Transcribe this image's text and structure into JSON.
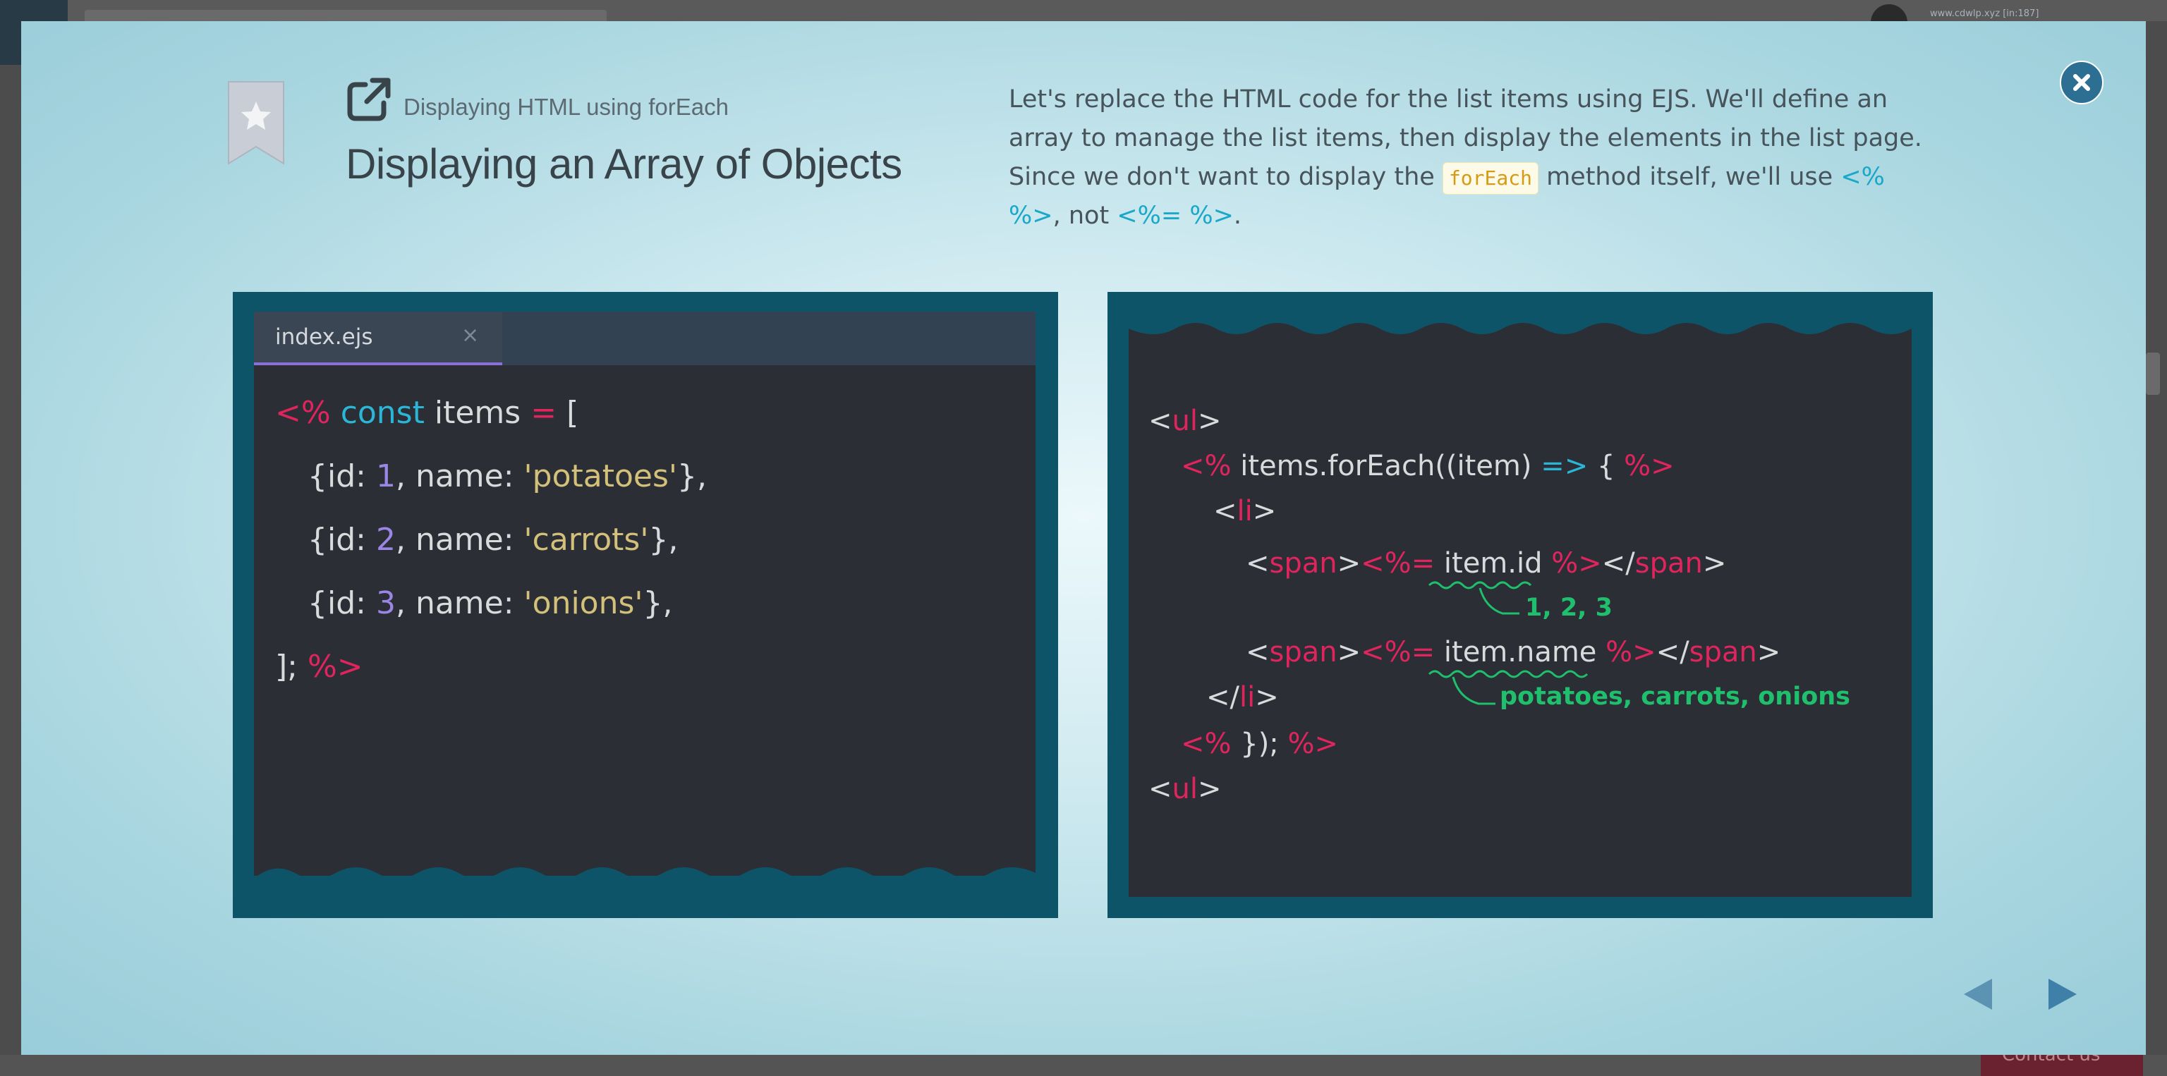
{
  "background": {
    "user_text": "www.cdwlp.xyz [in:187]",
    "contact_label": "Contact us"
  },
  "header": {
    "subtitle": "Displaying HTML using forEach",
    "title": "Displaying an Array of Objects"
  },
  "description": {
    "part1": "Let's replace the HTML code for the list items using EJS. We'll define an array to manage the list items, then display the elements in the list page. Since we don't want to display the ",
    "code": "forEach",
    "part2": " method itself, we'll use ",
    "token1": "<% %>",
    "part3": ", not ",
    "token2": "<%= %>",
    "part4": "."
  },
  "editor": {
    "tab_label": "index.ejs",
    "tab_close": "×"
  },
  "left_code": {
    "l1": {
      "a": "<%",
      "b": "const",
      "c": "items",
      "d": "=",
      "e": "["
    },
    "l2": {
      "a": "{id: ",
      "b": "1",
      "c": ", name: ",
      "d": "'potatoes'",
      "e": "},"
    },
    "l3": {
      "a": "{id: ",
      "b": "2",
      "c": ", name: ",
      "d": "'carrots'",
      "e": "},"
    },
    "l4": {
      "a": "{id: ",
      "b": "3",
      "c": ", name: ",
      "d": "'onions'",
      "e": "},"
    },
    "l5": {
      "a": "];",
      "b": "%>"
    }
  },
  "right_code": {
    "l1": {
      "a": "<",
      "b": "ul",
      "c": ">"
    },
    "l2": {
      "a": "<%",
      "b": "items.forEach((item)",
      "c": "=>",
      "d": "{",
      "e": "%>"
    },
    "l3": {
      "a": "<",
      "b": "li",
      "c": ">"
    },
    "l4": {
      "a": "<",
      "b": "span",
      "c": ">",
      "d": "<%=",
      "e": "item.id",
      "f": "%>",
      "g": "</",
      "h": "span",
      "i": ">"
    },
    "l5": {
      "a": "<",
      "b": "span",
      "c": ">",
      "d": "<%=",
      "e": "item.name",
      "f": "%>",
      "g": "</",
      "h": "span",
      "i": ">"
    },
    "l6": {
      "a": "</",
      "b": "li",
      "c": ">"
    },
    "l7": {
      "a": "<%",
      "b": "});",
      "c": "%>"
    },
    "l8": {
      "a": "<",
      "b": "ul",
      "c": ">"
    }
  },
  "annotations": {
    "ids": "1, 2, 3",
    "names": "potatoes, carrots, onions"
  },
  "colors": {
    "panel_frame": "#0e5468",
    "code_bg": "#2b2e34",
    "keyword_red": "#e0245e",
    "keyword_cyan": "#2bb6d8",
    "number_purple": "#9b86e6",
    "string_yellow": "#d3c07a",
    "annotation_green": "#1fbf6d",
    "close_button": "#2d6f93"
  },
  "icons": {
    "close": "close-icon",
    "bookmark": "bookmark-star-icon",
    "external_link": "external-link-icon",
    "prev": "prev-arrow-icon",
    "next": "next-arrow-icon"
  }
}
